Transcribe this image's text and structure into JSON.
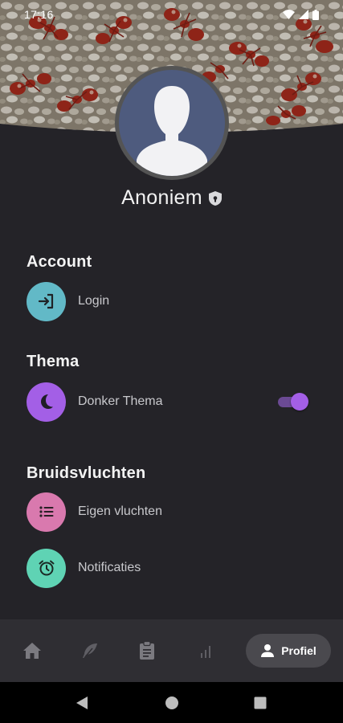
{
  "status_bar": {
    "time": "17:16"
  },
  "profile": {
    "name": "Anoniem"
  },
  "sections": {
    "account": {
      "title": "Account",
      "login_label": "Login"
    },
    "theme": {
      "title": "Thema",
      "dark_theme_label": "Donker Thema",
      "dark_theme_enabled": true
    },
    "nuptial_flights": {
      "title": "Bruidsvluchten",
      "own_flights_label": "Eigen vluchten",
      "notifications_label": "Notificaties"
    }
  },
  "bottom_nav": {
    "active_label": "Profiel"
  },
  "icons": {
    "login": "login-icon",
    "dark_theme": "moon-icon",
    "own_flights": "list-icon",
    "notifications": "alarm-icon",
    "home": "home-icon",
    "feather": "feather-icon",
    "clipboard": "clipboard-icon",
    "chart": "bar-chart-icon",
    "profile": "person-icon"
  },
  "colors": {
    "background": "#242328",
    "login_circle": "#62b9c7",
    "theme_circle": "#a35fe6",
    "flights_circle": "#d979ae",
    "notifications_circle": "#5fd3b4",
    "toggle_thumb": "#a35fe6",
    "nav_background": "#2f2e33"
  }
}
